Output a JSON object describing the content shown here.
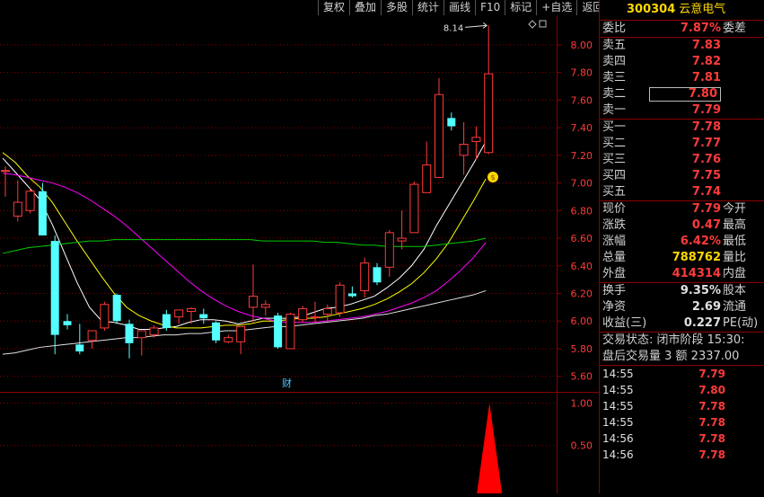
{
  "toolbar": [
    "复权",
    "叠加",
    "多股",
    "统计",
    "画线",
    "F10",
    "标记",
    "+自选",
    "返回"
  ],
  "stock": {
    "code": "300304",
    "name": "云意电气"
  },
  "quote_rows": [
    {
      "label": "委比",
      "value": "7.87%",
      "right": "委差",
      "color": "red"
    }
  ],
  "sell_rows": [
    {
      "label": "卖五",
      "value": "7.83",
      "color": "red"
    },
    {
      "label": "卖四",
      "value": "7.82",
      "color": "red"
    },
    {
      "label": "卖三",
      "value": "7.81",
      "color": "red"
    },
    {
      "label": "卖二",
      "value": "7.80",
      "color": "red",
      "boxed": true
    },
    {
      "label": "卖一",
      "value": "7.79",
      "color": "red"
    }
  ],
  "buy_rows": [
    {
      "label": "买一",
      "value": "7.78",
      "color": "red"
    },
    {
      "label": "买二",
      "value": "7.77",
      "color": "red"
    },
    {
      "label": "买三",
      "value": "7.76",
      "color": "red"
    },
    {
      "label": "买四",
      "value": "7.75",
      "color": "red"
    },
    {
      "label": "买五",
      "value": "7.74",
      "color": "red"
    }
  ],
  "stat_rows": [
    {
      "label": "现价",
      "value": "7.79",
      "right": "今开",
      "color": "red"
    },
    {
      "label": "涨跌",
      "value": "0.47",
      "right": "最高",
      "color": "red"
    },
    {
      "label": "涨幅",
      "value": "6.42%",
      "right": "最低",
      "color": "red"
    },
    {
      "label": "总量",
      "value": "788762",
      "right": "量比",
      "color": "yel"
    },
    {
      "label": "外盘",
      "value": "414314",
      "right": "内盘",
      "color": "red"
    }
  ],
  "fin_rows": [
    {
      "label": "换手",
      "value": "9.35%",
      "right": "股本",
      "color": "wht"
    },
    {
      "label": "净资",
      "value": "2.69",
      "right": "流通",
      "color": "wht"
    },
    {
      "label": "收益(三)",
      "value": "0.227",
      "right": "PE(动)",
      "color": "wht"
    }
  ],
  "status_line": "交易状态: 闭市阶段 15:30:",
  "after_hours_line": "盘后交易量 3 额 2337.00",
  "ticks": [
    {
      "time": "14:55",
      "price": "7.79"
    },
    {
      "time": "14:55",
      "price": "7.80"
    },
    {
      "time": "14:55",
      "price": "7.78"
    },
    {
      "time": "14:55",
      "price": "7.78"
    },
    {
      "time": "14:56",
      "price": "7.78"
    },
    {
      "time": "14:56",
      "price": "7.78"
    }
  ],
  "chart_data": {
    "type": "candlestick",
    "price_axis_ticks": [
      "8.00",
      "7.80",
      "7.60",
      "7.40",
      "7.20",
      "7.00",
      "6.80",
      "6.60",
      "6.40",
      "6.20",
      "6.00",
      "5.80",
      "5.60"
    ],
    "volume_axis_ticks": [
      "1.00",
      "0.50"
    ],
    "ylim": [
      5.52,
      8.24
    ],
    "high_annotation": "8.14",
    "event_marker": "财",
    "candles": [
      {
        "o": 7.09,
        "h": 7.12,
        "l": 6.9,
        "c": 7.09
      },
      {
        "o": 6.76,
        "h": 7.02,
        "l": 6.72,
        "c": 6.86
      },
      {
        "o": 6.8,
        "h": 6.96,
        "l": 6.78,
        "c": 6.94
      },
      {
        "o": 6.94,
        "h": 7.0,
        "l": 6.62,
        "c": 6.62
      },
      {
        "o": 6.58,
        "h": 6.62,
        "l": 5.76,
        "c": 5.9
      },
      {
        "o": 6.0,
        "h": 6.05,
        "l": 5.94,
        "c": 5.97
      },
      {
        "o": 5.83,
        "h": 5.98,
        "l": 5.76,
        "c": 5.78
      },
      {
        "o": 5.86,
        "h": 5.93,
        "l": 5.8,
        "c": 5.93
      },
      {
        "o": 5.95,
        "h": 6.14,
        "l": 5.93,
        "c": 6.12
      },
      {
        "o": 6.19,
        "h": 6.2,
        "l": 5.98,
        "c": 6.0
      },
      {
        "o": 5.98,
        "h": 6.01,
        "l": 5.73,
        "c": 5.84
      },
      {
        "o": 5.88,
        "h": 5.93,
        "l": 5.75,
        "c": 5.93
      },
      {
        "o": 5.9,
        "h": 5.97,
        "l": 5.88,
        "c": 5.95
      },
      {
        "o": 6.05,
        "h": 6.08,
        "l": 5.93,
        "c": 5.95
      },
      {
        "o": 6.03,
        "h": 6.08,
        "l": 5.98,
        "c": 6.08
      },
      {
        "o": 6.07,
        "h": 6.1,
        "l": 5.98,
        "c": 6.09
      },
      {
        "o": 6.05,
        "h": 6.09,
        "l": 5.98,
        "c": 6.02
      },
      {
        "o": 5.99,
        "h": 6.0,
        "l": 5.84,
        "c": 5.86
      },
      {
        "o": 5.85,
        "h": 5.9,
        "l": 5.84,
        "c": 5.88
      },
      {
        "o": 5.85,
        "h": 5.96,
        "l": 5.76,
        "c": 5.96
      },
      {
        "o": 6.1,
        "h": 6.41,
        "l": 5.99,
        "c": 6.18
      },
      {
        "o": 6.1,
        "h": 6.15,
        "l": 6.04,
        "c": 6.12
      },
      {
        "o": 6.04,
        "h": 6.06,
        "l": 5.8,
        "c": 5.81
      },
      {
        "o": 5.8,
        "h": 6.06,
        "l": 5.8,
        "c": 6.05
      },
      {
        "o": 6.01,
        "h": 6.11,
        "l": 5.99,
        "c": 6.09
      },
      {
        "o": 6.03,
        "h": 6.14,
        "l": 5.99,
        "c": 6.03
      },
      {
        "o": 6.05,
        "h": 6.12,
        "l": 6.0,
        "c": 6.09
      },
      {
        "o": 6.06,
        "h": 6.28,
        "l": 6.03,
        "c": 6.26
      },
      {
        "o": 6.2,
        "h": 6.25,
        "l": 6.17,
        "c": 6.18
      },
      {
        "o": 6.22,
        "h": 6.46,
        "l": 6.17,
        "c": 6.42
      },
      {
        "o": 6.39,
        "h": 6.42,
        "l": 6.26,
        "c": 6.28
      },
      {
        "o": 6.39,
        "h": 6.66,
        "l": 6.32,
        "c": 6.64
      },
      {
        "o": 6.58,
        "h": 6.8,
        "l": 6.52,
        "c": 6.6
      },
      {
        "o": 6.64,
        "h": 7.01,
        "l": 6.64,
        "c": 6.99
      },
      {
        "o": 6.93,
        "h": 7.3,
        "l": 6.93,
        "c": 7.13
      },
      {
        "o": 7.04,
        "h": 7.76,
        "l": 7.04,
        "c": 7.64
      },
      {
        "o": 7.47,
        "h": 7.51,
        "l": 7.38,
        "c": 7.41
      },
      {
        "o": 7.2,
        "h": 7.44,
        "l": 7.06,
        "c": 7.28
      },
      {
        "o": 7.3,
        "h": 7.41,
        "l": 7.17,
        "c": 7.33
      },
      {
        "o": 7.22,
        "h": 8.14,
        "l": 7.21,
        "c": 7.79
      }
    ],
    "ma_series": [
      {
        "color": "#ffffff",
        "values": [
          7.18,
          7.08,
          6.98,
          6.88,
          6.7,
          6.49,
          6.28,
          6.1,
          6.0,
          5.99,
          5.97,
          5.94,
          5.94,
          5.95,
          5.96,
          5.99,
          6.01,
          6.01,
          6.0,
          5.98,
          6.0,
          6.02,
          6.02,
          6.02,
          6.03,
          6.06,
          6.09,
          6.1,
          6.12,
          6.15,
          6.18,
          6.24,
          6.31,
          6.4,
          6.52,
          6.69,
          6.84,
          6.99,
          7.14,
          7.3
        ]
      },
      {
        "color": "#ffff00",
        "values": [
          7.22,
          7.15,
          7.05,
          6.97,
          6.86,
          6.72,
          6.58,
          6.45,
          6.32,
          6.2,
          6.1,
          6.04,
          6.0,
          5.97,
          5.95,
          5.95,
          5.95,
          5.96,
          5.97,
          5.97,
          5.98,
          6.0,
          6.0,
          6.01,
          6.02,
          6.02,
          6.03,
          6.05,
          6.07,
          6.09,
          6.12,
          6.16,
          6.21,
          6.27,
          6.35,
          6.45,
          6.57,
          6.72,
          6.87,
          7.03
        ]
      },
      {
        "color": "#ff00ff",
        "values": [
          7.07,
          7.06,
          7.04,
          7.02,
          7.0,
          6.97,
          6.93,
          6.88,
          6.82,
          6.76,
          6.69,
          6.61,
          6.53,
          6.45,
          6.37,
          6.29,
          6.22,
          6.16,
          6.11,
          6.07,
          6.04,
          6.02,
          6.0,
          5.99,
          5.99,
          5.99,
          6.0,
          6.01,
          6.02,
          6.03,
          6.05,
          6.07,
          6.1,
          6.13,
          6.17,
          6.22,
          6.29,
          6.37,
          6.46,
          6.57
        ]
      },
      {
        "color": "#00cc00",
        "values": [
          6.49,
          6.51,
          6.53,
          6.54,
          6.55,
          6.56,
          6.57,
          6.58,
          6.58,
          6.59,
          6.59,
          6.59,
          6.59,
          6.59,
          6.59,
          6.59,
          6.59,
          6.59,
          6.59,
          6.59,
          6.59,
          6.58,
          6.58,
          6.58,
          6.58,
          6.58,
          6.57,
          6.57,
          6.56,
          6.55,
          6.55,
          6.54,
          6.54,
          6.54,
          6.54,
          6.55,
          6.56,
          6.57,
          6.58,
          6.6
        ]
      },
      {
        "color": "#e0e0e0",
        "values": [
          5.76,
          5.77,
          5.79,
          5.81,
          5.82,
          5.83,
          5.84,
          5.85,
          5.86,
          5.87,
          5.88,
          5.88,
          5.89,
          5.9,
          5.9,
          5.91,
          5.91,
          5.92,
          5.93,
          5.93,
          5.94,
          5.95,
          5.96,
          5.96,
          5.97,
          5.98,
          5.99,
          6.0,
          6.01,
          6.02,
          6.04,
          6.05,
          6.07,
          6.09,
          6.11,
          6.13,
          6.15,
          6.17,
          6.19,
          6.22
        ]
      }
    ],
    "volume": {
      "last_bar_value": 1.0
    }
  }
}
